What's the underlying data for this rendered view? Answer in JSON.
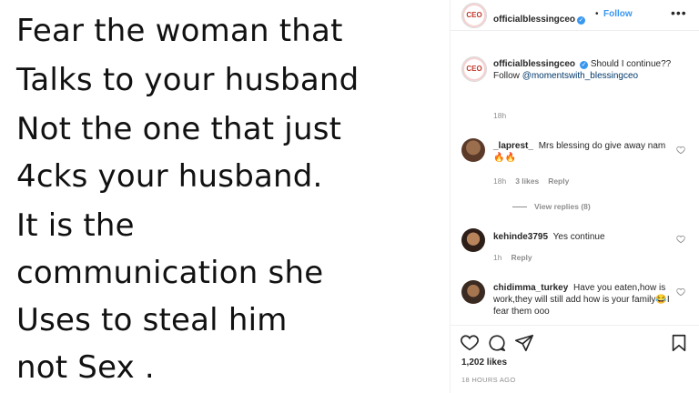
{
  "post_image": {
    "lines": [
      "Fear the woman that",
      "Talks to your husband",
      "Not the one that just",
      "4cks your husband.",
      "It is the",
      "communication she",
      "Uses to steal him",
      "not Sex ."
    ]
  },
  "header": {
    "avatar_text": "CEO",
    "username": "officialblessingceo",
    "separator": "•",
    "follow_label": "Follow",
    "more_label": "•••"
  },
  "caption": {
    "avatar_text": "CEO",
    "username": "officialblessingceo",
    "text_1": "Should I continue??",
    "text_2": "Follow ",
    "mention": "@momentswith_blessingceo",
    "time": "18h"
  },
  "comments": [
    {
      "username": "_laprest_",
      "text": "Mrs blessing do give away nam🔥🔥",
      "time": "18h",
      "likes": "3 likes",
      "reply": "Reply"
    },
    {
      "username": "kehinde3795",
      "text": "Yes continue",
      "time": "1h",
      "reply": "Reply"
    },
    {
      "username": "chidimma_turkey",
      "text": "Have you eaten,how is work,they will still add how is your family😂I fear them ooo"
    }
  ],
  "view_replies": "View replies (8)",
  "likes_count": "1,202 likes",
  "post_time": "18 HOURS AGO",
  "colors": {
    "accent_blue": "#3897f0",
    "muted_gray": "#8e8e8e",
    "text_dark": "#262626"
  }
}
